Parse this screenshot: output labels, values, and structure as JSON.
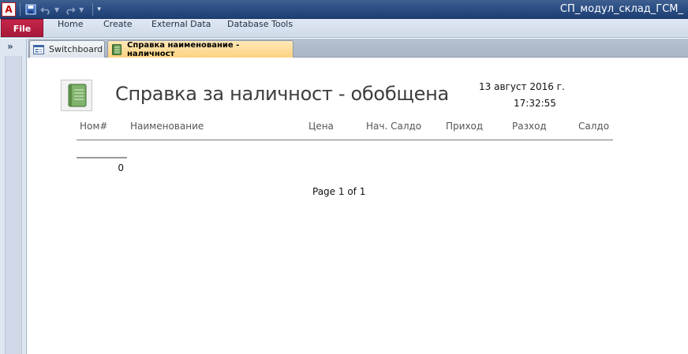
{
  "window": {
    "app_icon_letter": "A",
    "title": "СП_модул_склад_ГСМ_"
  },
  "ribbon": {
    "file_label": "File",
    "tabs": [
      {
        "label": "Home"
      },
      {
        "label": "Create"
      },
      {
        "label": "External Data"
      },
      {
        "label": "Database Tools"
      }
    ]
  },
  "nav_pane": {
    "toggle_glyph": "»"
  },
  "doc_tabs": [
    {
      "label": "Switchboard",
      "active": false,
      "icon": "form-icon"
    },
    {
      "label": "Справка наименование -  наличност",
      "active": true,
      "icon": "report-icon"
    }
  ],
  "report": {
    "title": "Справка за наличност - обобщена",
    "date": "13 август 2016 г.",
    "time": "17:32:55",
    "columns": [
      "Ном#",
      "Наименование",
      "Цена",
      "Нач. Салдо",
      "Приход",
      "Разход",
      "Салдо"
    ],
    "total_value": "0",
    "page_text": "Page 1 of 1"
  },
  "colors": {
    "title_bar": "#2c4f85",
    "file_tab": "#b51f42",
    "active_doc_tab": "#fcd27f"
  }
}
